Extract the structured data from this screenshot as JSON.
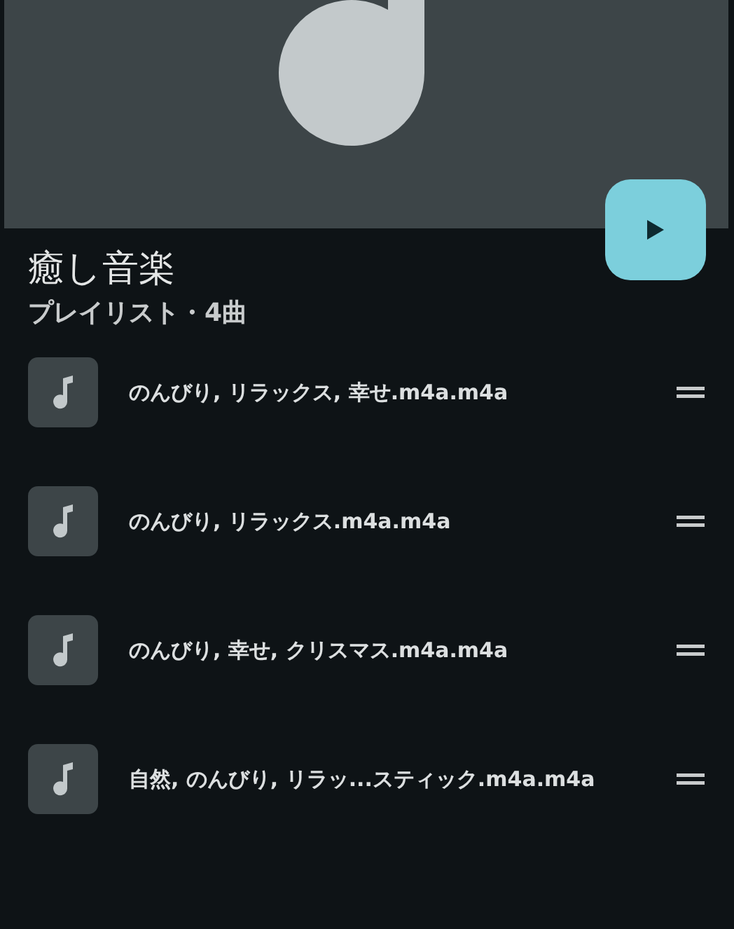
{
  "playlist": {
    "title": "癒し音楽",
    "subtitle": "プレイリスト・4曲"
  },
  "tracks": [
    {
      "name": "のんびり, リラックス, 幸せ.m4a.m4a"
    },
    {
      "name": "のんびり, リラックス.m4a.m4a"
    },
    {
      "name": "のんびり, 幸せ, クリスマス.m4a.m4a"
    },
    {
      "name": "自然, のんびり, リラッ...スティック.m4a.m4a"
    }
  ]
}
